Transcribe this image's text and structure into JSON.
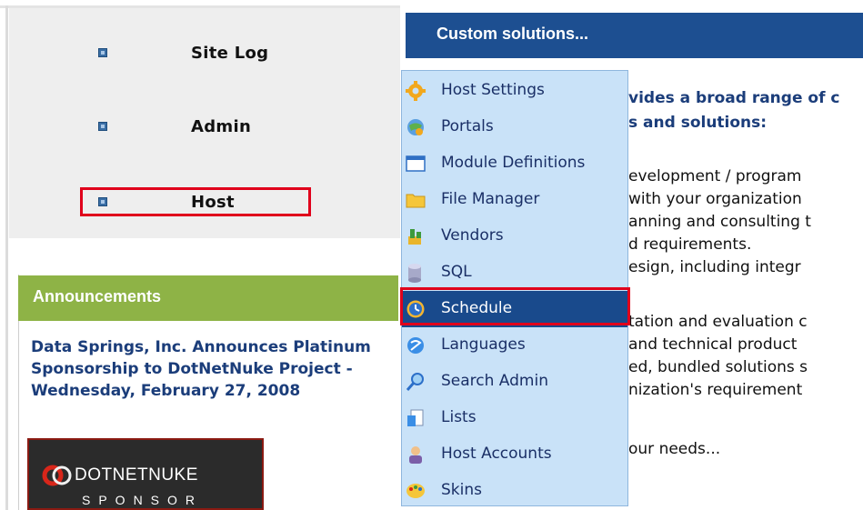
{
  "nav": {
    "items": [
      {
        "label": "Site Log"
      },
      {
        "label": "Admin"
      },
      {
        "label": "Host"
      }
    ]
  },
  "announcements": {
    "title": "Announcements",
    "text": "Data Springs, Inc. Announces Platinum Sponsorship to DotNetNuke Project - Wednesday, February 27, 2008",
    "sponsor_line1": "DOTNETNUKE",
    "sponsor_line2": "SPONSOR"
  },
  "content": {
    "title": "Custom solutions...",
    "lines": [
      "vides a broad range of c",
      "s and solutions:",
      "evelopment / program",
      " with your organization",
      "anning and consulting t",
      "d requirements.",
      "esign, including integr",
      "tation and evaluation c",
      " and technical product",
      "ed, bundled solutions s",
      "nization's requirement",
      "our needs..."
    ]
  },
  "menu": {
    "items": [
      {
        "label": "Host Settings",
        "icon": "gear-icon"
      },
      {
        "label": "Portals",
        "icon": "globe-icon"
      },
      {
        "label": "Module Definitions",
        "icon": "window-icon"
      },
      {
        "label": "File Manager",
        "icon": "folder-icon"
      },
      {
        "label": "Vendors",
        "icon": "vendor-icon"
      },
      {
        "label": "SQL",
        "icon": "database-icon"
      },
      {
        "label": "Schedule",
        "icon": "clock-icon",
        "selected": true
      },
      {
        "label": "Languages",
        "icon": "languages-icon"
      },
      {
        "label": "Search Admin",
        "icon": "search-icon"
      },
      {
        "label": "Lists",
        "icon": "lists-icon"
      },
      {
        "label": "Host Accounts",
        "icon": "user-icon"
      },
      {
        "label": "Skins",
        "icon": "palette-icon"
      }
    ]
  },
  "colors": {
    "content_header": "#1d4f91",
    "announce_header": "#8eb346",
    "menu_bg": "#c9e2f8",
    "menu_selected": "#194a8c",
    "highlight": "#e0001b"
  }
}
